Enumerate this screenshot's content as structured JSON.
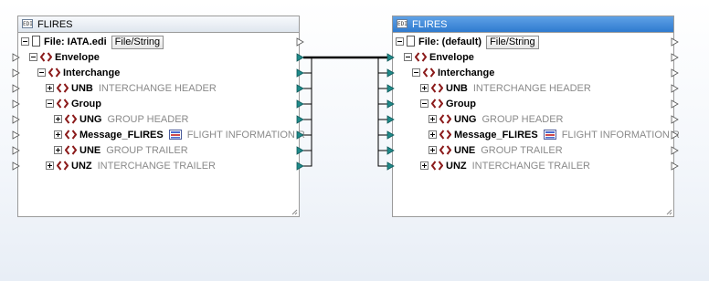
{
  "source": {
    "title": "FLIRES",
    "rows": [
      {
        "label": "File: IATA.edi",
        "button": "File/String",
        "desc": ""
      },
      {
        "label": "Envelope",
        "desc": ""
      },
      {
        "label": "Interchange",
        "desc": ""
      },
      {
        "label": "UNB",
        "desc": "INTERCHANGE HEADER"
      },
      {
        "label": "Group",
        "desc": ""
      },
      {
        "label": "UNG",
        "desc": "GROUP HEADER"
      },
      {
        "label": "Message_FLIRES",
        "desc": "FLIGHT INFORMATION R"
      },
      {
        "label": "UNE",
        "desc": "GROUP TRAILER"
      },
      {
        "label": "UNZ",
        "desc": "INTERCHANGE TRAILER"
      }
    ]
  },
  "target": {
    "title": "FLIRES",
    "rows": [
      {
        "label": "File: (default)",
        "button": "File/String",
        "desc": ""
      },
      {
        "label": "Envelope",
        "desc": ""
      },
      {
        "label": "Interchange",
        "desc": ""
      },
      {
        "label": "UNB",
        "desc": "INTERCHANGE HEADER"
      },
      {
        "label": "Group",
        "desc": ""
      },
      {
        "label": "UNG",
        "desc": "GROUP HEADER"
      },
      {
        "label": "Message_FLIRES",
        "desc": "FLIGHT INFORMATION R"
      },
      {
        "label": "UNE",
        "desc": "GROUP TRAILER"
      },
      {
        "label": "UNZ",
        "desc": "INTERCHANGE TRAILER"
      }
    ]
  },
  "icons": {
    "component": "edi-component-icon",
    "file": "file-icon",
    "element": "edi-element-icon",
    "message": "message-grid-icon",
    "expander_open": "collapse-icon",
    "expander_closed": "expand-icon"
  },
  "colors": {
    "element_icon": "#8b1a1a",
    "connection": "#000000",
    "port_connected": "#1f8a8a",
    "active_title": "#3b86d8",
    "description_text": "#8a8a8a"
  }
}
